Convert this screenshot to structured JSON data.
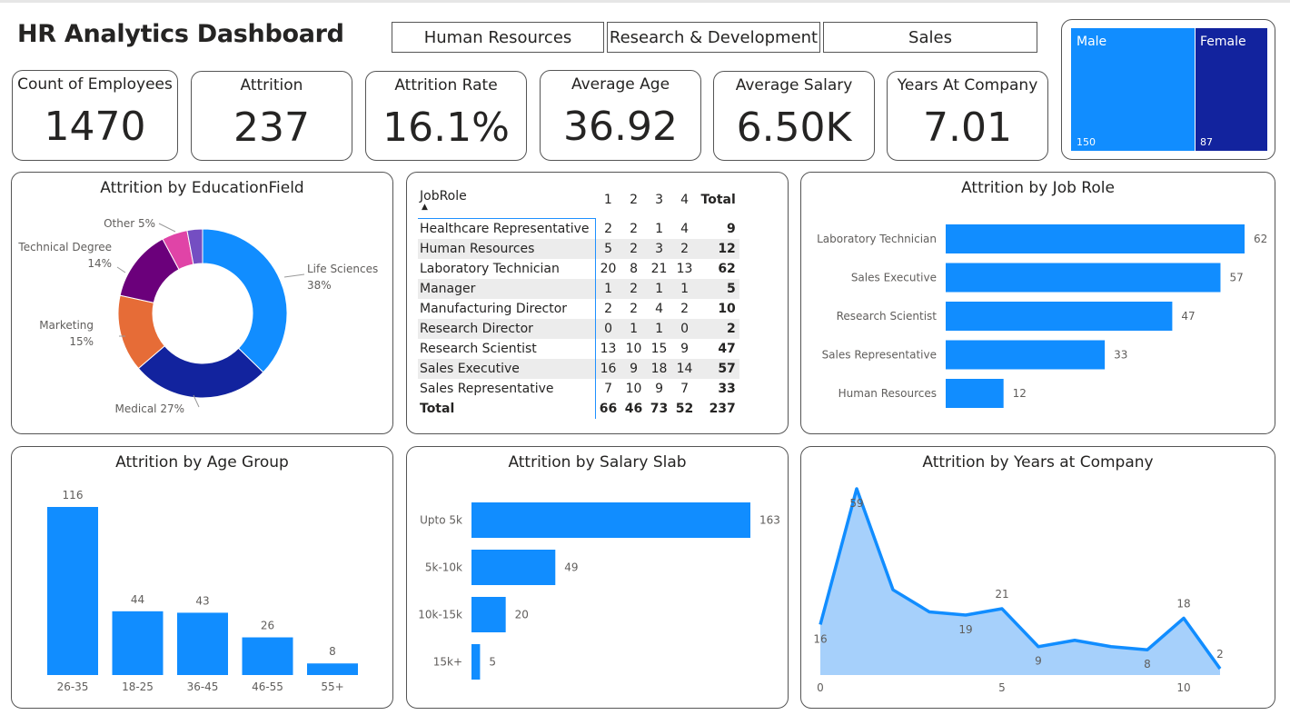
{
  "title": "HR Analytics Dashboard",
  "slicers": [
    "Human Resources",
    "Research & Development",
    "Sales"
  ],
  "kpis": [
    {
      "label": "Count of Employees",
      "value": "1470"
    },
    {
      "label": "Attrition",
      "value": "237"
    },
    {
      "label": "Attrition Rate",
      "value": "16.1%"
    },
    {
      "label": "Average Age",
      "value": "36.92"
    },
    {
      "label": "Average Salary",
      "value": "6.50K"
    },
    {
      "label": "Years At Company",
      "value": "7.01"
    }
  ],
  "gender": {
    "male_label": "Male",
    "male_value": "150",
    "female_label": "Female",
    "female_value": "87",
    "colors": {
      "male": "#118dff",
      "female": "#12239e"
    }
  },
  "matrix": {
    "header": {
      "jobrole": "JobRole",
      "cols": [
        "1",
        "2",
        "3",
        "4"
      ],
      "total": "Total"
    },
    "rows": [
      {
        "name": "Healthcare Representative",
        "v": [
          "2",
          "2",
          "1",
          "4"
        ],
        "t": "9"
      },
      {
        "name": "Human Resources",
        "v": [
          "5",
          "2",
          "3",
          "2"
        ],
        "t": "12"
      },
      {
        "name": "Laboratory Technician",
        "v": [
          "20",
          "8",
          "21",
          "13"
        ],
        "t": "62"
      },
      {
        "name": "Manager",
        "v": [
          "1",
          "2",
          "1",
          "1"
        ],
        "t": "5"
      },
      {
        "name": "Manufacturing Director",
        "v": [
          "2",
          "2",
          "4",
          "2"
        ],
        "t": "10"
      },
      {
        "name": "Research Director",
        "v": [
          "0",
          "1",
          "1",
          "0"
        ],
        "t": "2"
      },
      {
        "name": "Research Scientist",
        "v": [
          "13",
          "10",
          "15",
          "9"
        ],
        "t": "47"
      },
      {
        "name": "Sales Executive",
        "v": [
          "16",
          "9",
          "18",
          "14"
        ],
        "t": "57"
      },
      {
        "name": "Sales Representative",
        "v": [
          "7",
          "10",
          "9",
          "7"
        ],
        "t": "33"
      }
    ],
    "total": {
      "name": "Total",
      "v": [
        "66",
        "46",
        "73",
        "52"
      ],
      "t": "237"
    }
  },
  "chart_data": [
    {
      "type": "pie",
      "title": "Attrition by EducationField",
      "slices": [
        {
          "label": "Life Sciences",
          "pct_label": "38%",
          "value": 38,
          "color": "#118dff"
        },
        {
          "label": "Medical",
          "pct_label": "27%",
          "value": 27,
          "color": "#12239e"
        },
        {
          "label": "Marketing",
          "pct_label": "15%",
          "value": 15,
          "color": "#e66c37"
        },
        {
          "label": "Technical Degree",
          "pct_label": "14%",
          "value": 14,
          "color": "#6b007b"
        },
        {
          "label": "Other",
          "pct_label": "5%",
          "value": 5,
          "color": "#e044a7"
        },
        {
          "label": "",
          "pct_label": "",
          "value": 3,
          "color": "#744ec2"
        }
      ]
    },
    {
      "type": "bar",
      "orientation": "horizontal",
      "title": "Attrition by Job Role",
      "categories": [
        "Laboratory Technician",
        "Sales Executive",
        "Research Scientist",
        "Sales Representative",
        "Human Resources"
      ],
      "values": [
        62,
        57,
        47,
        33,
        12
      ],
      "color": "#118dff"
    },
    {
      "type": "bar",
      "orientation": "vertical",
      "title": "Attrition by Age Group",
      "categories": [
        "26-35",
        "18-25",
        "36-45",
        "46-55",
        "55+"
      ],
      "values": [
        116,
        44,
        43,
        26,
        8
      ],
      "color": "#118dff"
    },
    {
      "type": "bar",
      "orientation": "horizontal",
      "title": "Attrition by Salary Slab",
      "categories": [
        "Upto 5k",
        "5k-10k",
        "10k-15k",
        "15k+"
      ],
      "values": [
        163,
        49,
        20,
        5
      ],
      "color": "#118dff"
    },
    {
      "type": "area",
      "title": "Attrition by Years at Company",
      "x": [
        0,
        1,
        2,
        3,
        4,
        5,
        6,
        7,
        8,
        9,
        10,
        11
      ],
      "values": [
        16,
        59,
        27,
        20,
        19,
        21,
        9,
        11,
        9,
        8,
        18,
        2
      ],
      "point_labels": {
        "0": "16",
        "1": "59",
        "4": "19",
        "5": "21",
        "6": "9",
        "9": "8",
        "10": "18",
        "11": "2"
      },
      "xticks": [
        0,
        5,
        10
      ],
      "color": "#118dff",
      "fill": "#a6d0fb"
    }
  ]
}
